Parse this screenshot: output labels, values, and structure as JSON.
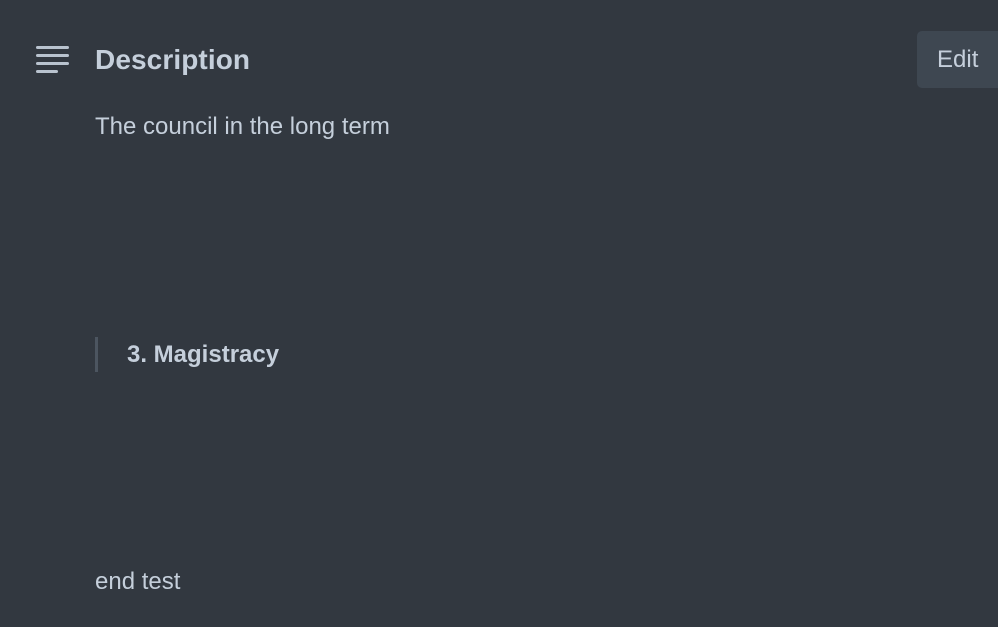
{
  "header": {
    "icon": "text-align-left-icon",
    "title": "Description",
    "edit_label": "Edit"
  },
  "description": {
    "first_line": "The council in the long term",
    "blockquote": "3. Magistracy",
    "last_line": "end test"
  },
  "colors": {
    "background": "#323840",
    "text": "#c5cfdb",
    "button_bg": "#3e4751",
    "quote_border": "#4c5560"
  }
}
